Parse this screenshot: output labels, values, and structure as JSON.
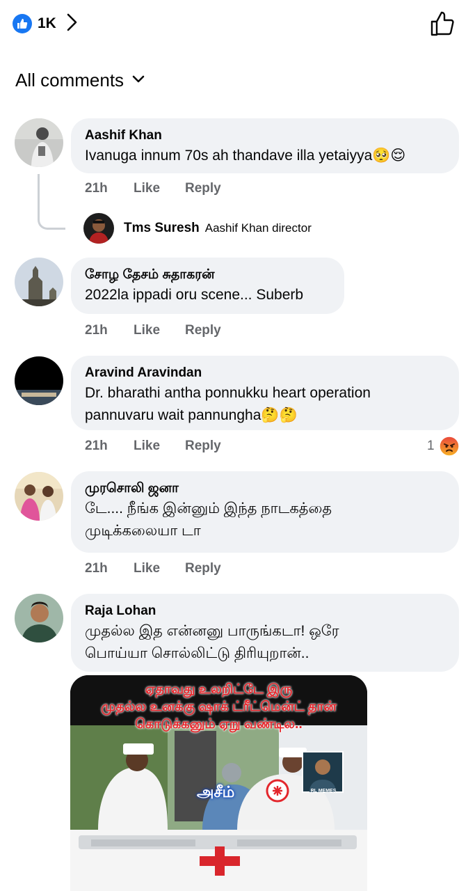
{
  "header": {
    "like_count": "1K",
    "like_icon": "thumbs-up-icon",
    "chevron_icon": "chevron-right-icon",
    "action_icon": "thumbs-up-outline-icon"
  },
  "filter": {
    "label": "All comments",
    "icon": "chevron-down-icon"
  },
  "comments": [
    {
      "author": "Aashif Khan",
      "text": "Ivanuga innum 70s ah thandave illa yetaiyya🥺😌",
      "time": "21h",
      "like_label": "Like",
      "reply_label": "Reply",
      "replies": [
        {
          "author": "Tms Suresh",
          "text": "Aashif Khan director"
        }
      ]
    },
    {
      "author": "சோழ தேசம் சுதாகரன்",
      "text": "2022la ippadi oru scene... Suberb",
      "time": "21h",
      "like_label": "Like",
      "reply_label": "Reply"
    },
    {
      "author": "Aravind Aravindan",
      "text_line1": "Dr. bharathi antha ponnukku heart operation",
      "text_line2": "pannuvaru wait pannungha🤔🤔",
      "time": "21h",
      "like_label": "Like",
      "reply_label": "Reply",
      "reaction_count": "1",
      "reaction_icon": "angry-face-icon"
    },
    {
      "author": "முரசொலி ஜனா",
      "text_line1": "டே.... நீங்க இன்னும் இந்த நாடகத்தை",
      "text_line2": "முடிக்கலையா டா",
      "time": "21h",
      "like_label": "Like",
      "reply_label": "Reply"
    },
    {
      "author": "Raja Lohan",
      "text_line1": "முதல்ல இத என்னனு பாருங்கடா! ஒரே",
      "text_line2": "பொய்யா சொல்லிட்டு திரியுறான்..",
      "meme": {
        "caption_line1": "ஏதாவது உலறிட்டே இரு",
        "caption_line2": "முதல்ல உனக்கு ஷாக் ட்ரீட்மென்ட் தான்",
        "caption_line3": "கொடுக்கனும் ஏறு வண்டில..",
        "tag": "அசீம்",
        "badge": "RL MEMES"
      }
    }
  ],
  "colors": {
    "accent": "#1877f2",
    "bubble": "#f0f2f5",
    "meta_text": "#65676b",
    "text": "#050505"
  }
}
